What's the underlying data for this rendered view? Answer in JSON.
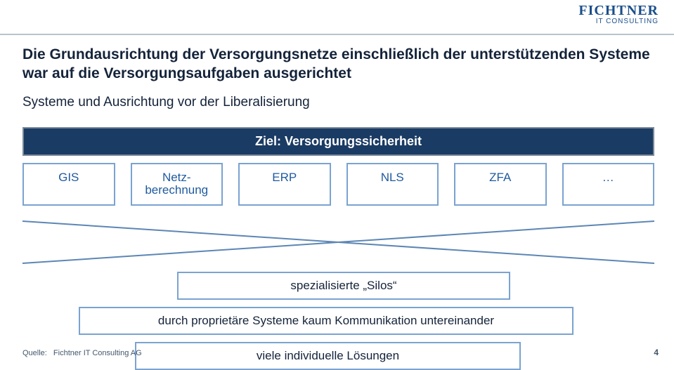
{
  "brand": {
    "name": "FICHTNER",
    "sub": "IT CONSULTING"
  },
  "title_line1": "Die Grundausrichtung der Versorgungsnetze einschließlich der unterstützenden Systeme",
  "title_line2": "war auf die Versorgungsaufgaben ausgerichtet",
  "subtitle": "Systeme und Ausrichtung vor der Liberalisierung",
  "banner": "Ziel: Versorgungssicherheit",
  "boxes": [
    "GIS",
    "Netz-",
    "berechnung",
    "ERP",
    "NLS",
    "ZFA",
    "…"
  ],
  "box_labels": {
    "b0": "GIS",
    "b1a": "Netz-",
    "b1b": "berechnung",
    "b2": "ERP",
    "b3": "NLS",
    "b4": "ZFA",
    "b5": "…"
  },
  "bars": {
    "bar1": "spezialisierte „Silos“",
    "bar2": "durch proprietäre Systeme kaum Kommunikation untereinander",
    "bar3": "viele individuelle Lösungen"
  },
  "footer": {
    "label": "Quelle:",
    "value": "Fichtner IT Consulting AG"
  },
  "page_number": "4",
  "colors": {
    "navy": "#1a3b63",
    "boxBorder": "#7aa3d1",
    "boxText": "#1f5a9e"
  }
}
